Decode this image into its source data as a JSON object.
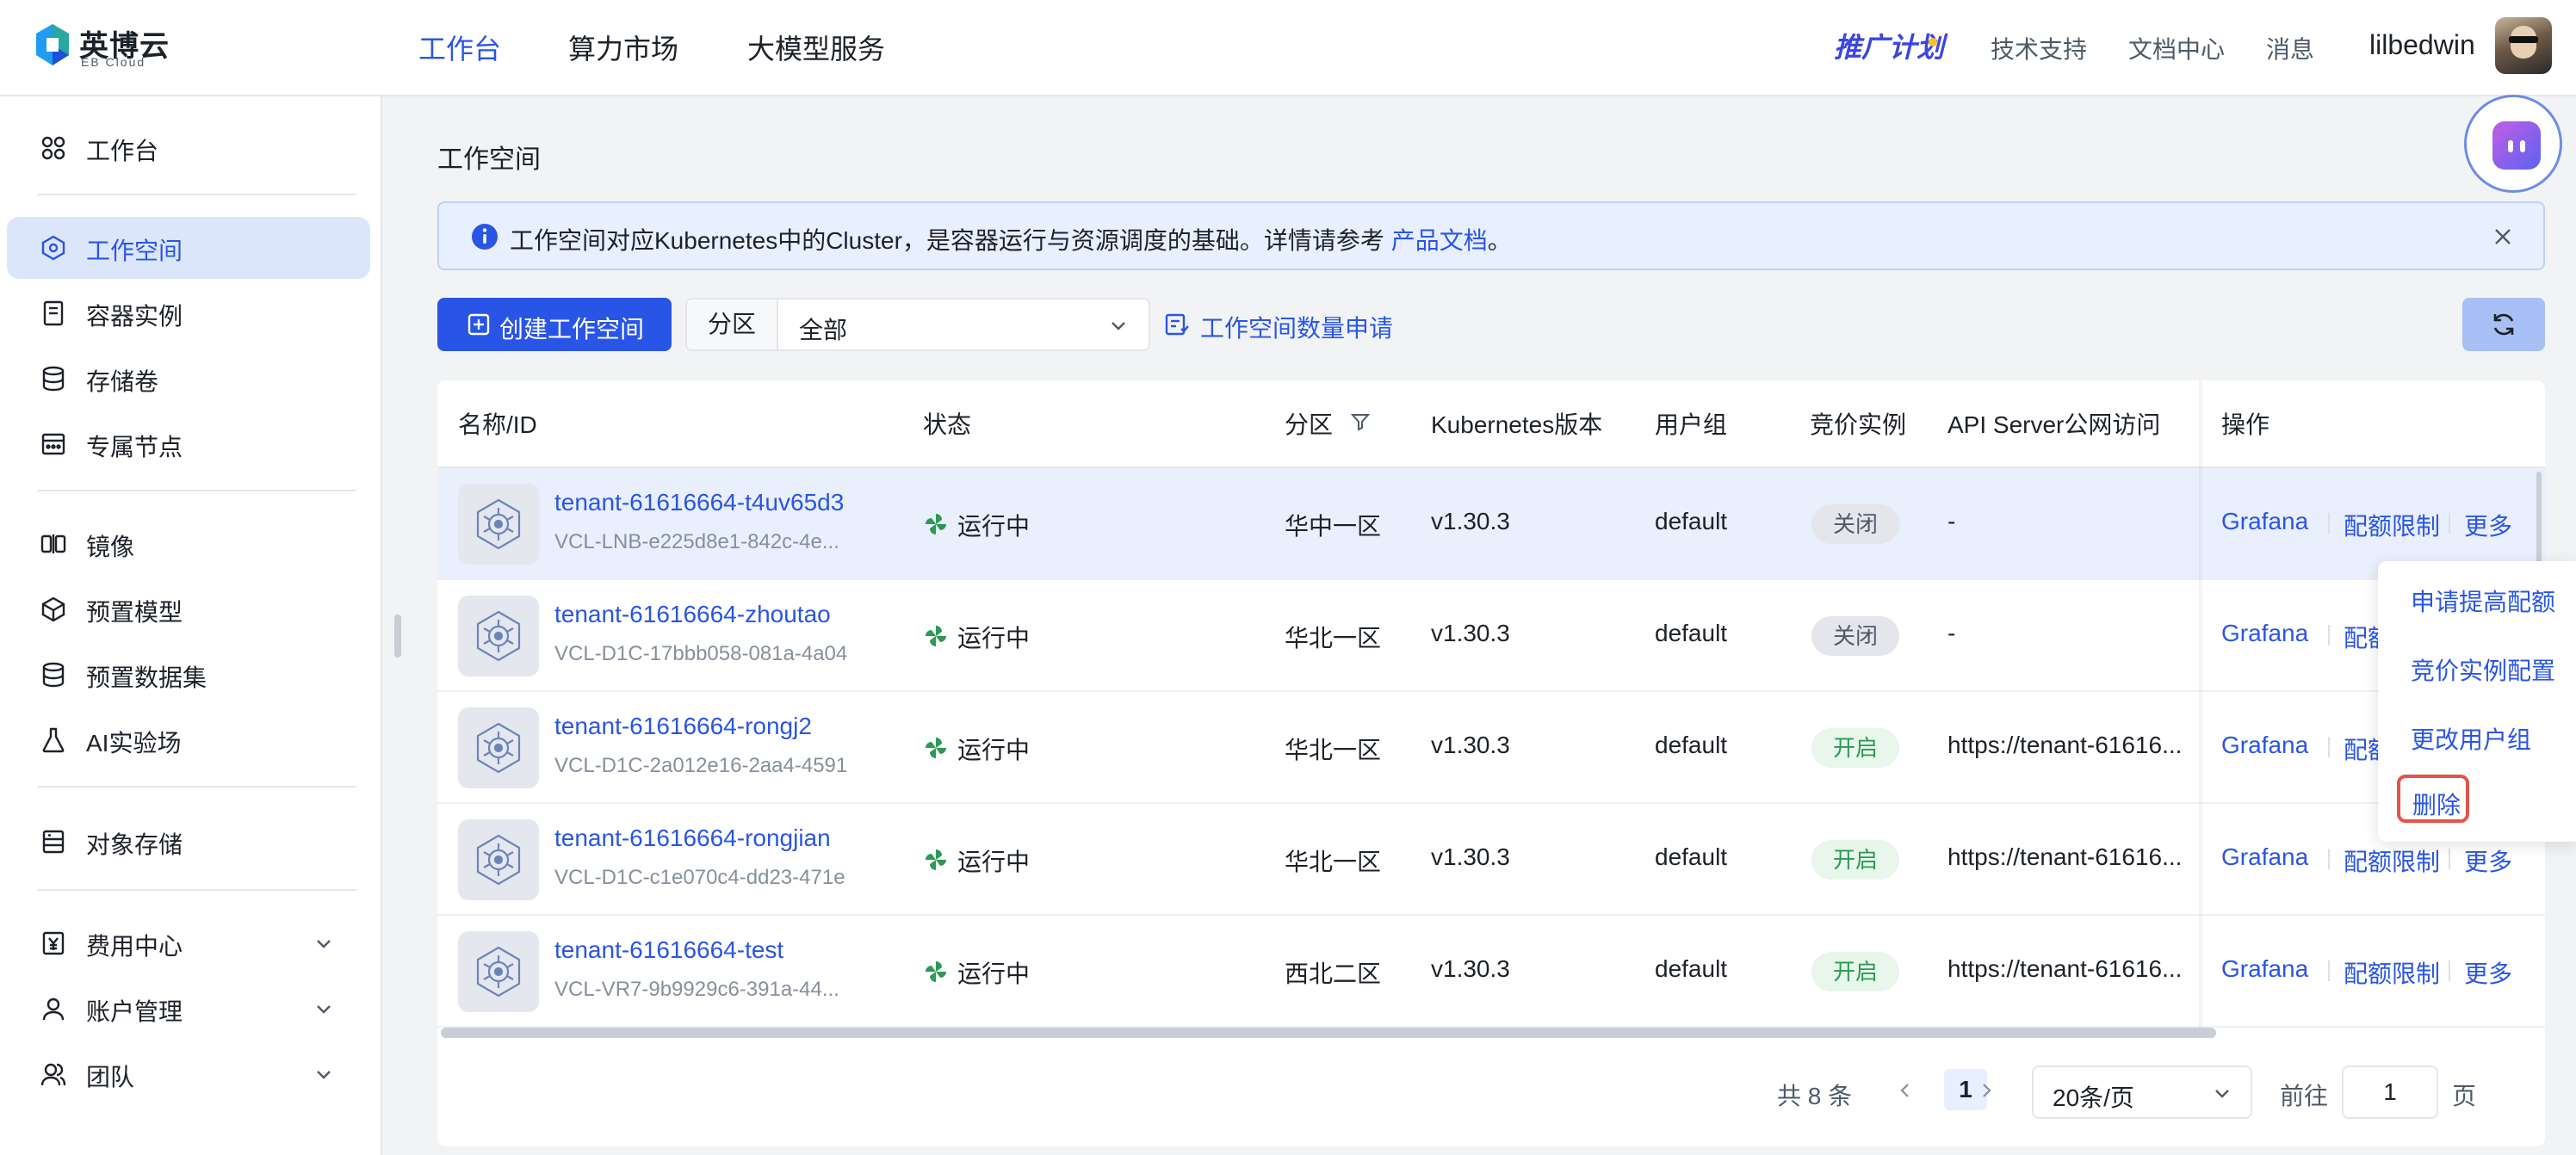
{
  "header": {
    "logo_text": "英博云",
    "logo_sub": "EB Cloud",
    "nav": [
      "工作台",
      "算力市场",
      "大模型服务"
    ],
    "promo": "推广计划",
    "links": [
      "技术支持",
      "文档中心",
      "消息"
    ],
    "username": "lilbedwin"
  },
  "sidebar": {
    "items": [
      {
        "label": "工作台",
        "icon": "dashboard-icon"
      },
      {
        "label": "工作空间",
        "icon": "workspace-icon"
      },
      {
        "label": "容器实例",
        "icon": "container-icon"
      },
      {
        "label": "存储卷",
        "icon": "storage-icon"
      },
      {
        "label": "专属节点",
        "icon": "node-icon"
      },
      {
        "label": "镜像",
        "icon": "image-icon"
      },
      {
        "label": "预置模型",
        "icon": "model-icon"
      },
      {
        "label": "预置数据集",
        "icon": "dataset-icon"
      },
      {
        "label": "AI实验场",
        "icon": "flask-icon"
      },
      {
        "label": "对象存储",
        "icon": "object-storage-icon"
      },
      {
        "label": "费用中心",
        "icon": "billing-icon"
      },
      {
        "label": "账户管理",
        "icon": "account-icon"
      },
      {
        "label": "团队",
        "icon": "team-icon"
      }
    ]
  },
  "page": {
    "title": "工作空间",
    "alert_text": "工作空间对应Kubernetes中的Cluster，是容器运行与资源调度的基础。详情请参考 ",
    "alert_link": "产品文档",
    "alert_end": "。",
    "create_button": "创建工作空间",
    "filter_label": "分区",
    "filter_value": "全部",
    "quota_link": "工作空间数量申请"
  },
  "table": {
    "headers": [
      "名称/ID",
      "状态",
      "分区",
      "Kubernetes版本",
      "用户组",
      "竞价实例",
      "API Server公网访问",
      "操作"
    ],
    "rows": [
      {
        "name": "tenant-61616664-t4uv65d3",
        "id": "VCL-LNB-e225d8e1-842c-4e...",
        "status": "运行中",
        "zone": "华中一区",
        "k8s": "v1.30.3",
        "group": "default",
        "spot": "关闭",
        "spot_on": false,
        "api": "-"
      },
      {
        "name": "tenant-61616664-zhoutao",
        "id": "VCL-D1C-17bbb058-081a-4a04",
        "status": "运行中",
        "zone": "华北一区",
        "k8s": "v1.30.3",
        "group": "default",
        "spot": "关闭",
        "spot_on": false,
        "api": "-"
      },
      {
        "name": "tenant-61616664-rongj2",
        "id": "VCL-D1C-2a012e16-2aa4-4591",
        "status": "运行中",
        "zone": "华北一区",
        "k8s": "v1.30.3",
        "group": "default",
        "spot": "开启",
        "spot_on": true,
        "api": "https://tenant-61616..."
      },
      {
        "name": "tenant-61616664-rongjian",
        "id": "VCL-D1C-c1e070c4-dd23-471e",
        "status": "运行中",
        "zone": "华北一区",
        "k8s": "v1.30.3",
        "group": "default",
        "spot": "开启",
        "spot_on": true,
        "api": "https://tenant-61616..."
      },
      {
        "name": "tenant-61616664-test",
        "id": "VCL-VR7-9b9929c6-391a-44...",
        "status": "运行中",
        "zone": "西北二区",
        "k8s": "v1.30.3",
        "group": "default",
        "spot": "开启",
        "spot_on": true,
        "api": "https://tenant-61616..."
      }
    ],
    "ops": {
      "grafana": "Grafana",
      "quota": "配额限制",
      "more": "更多"
    }
  },
  "dropdown": {
    "items": [
      "申请提高配额",
      "竞价实例配置",
      "更改用户组"
    ],
    "delete": "删除"
  },
  "pagination": {
    "total": "共 8 条",
    "current": "1",
    "page_size": "20条/页",
    "goto_label": "前往",
    "goto_value": "1",
    "page_suffix": "页"
  },
  "colors": {
    "primary": "#2955e6",
    "active_bg": "#dce6fb",
    "running": "#2b9a53",
    "danger": "#e5534b"
  }
}
